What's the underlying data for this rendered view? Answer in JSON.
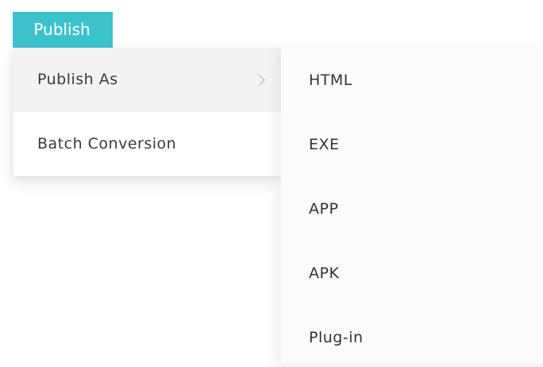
{
  "toolbar": {
    "publish_label": "Publish",
    "accent_color": "#3cc2cd"
  },
  "main_menu": {
    "items": [
      {
        "label": "Publish As",
        "has_submenu": true,
        "active": true,
        "icon": "chevron-right-icon"
      },
      {
        "label": "Batch Conversion",
        "has_submenu": false,
        "active": false
      }
    ]
  },
  "submenu": {
    "parent": "Publish As",
    "items": [
      {
        "label": "HTML"
      },
      {
        "label": "EXE"
      },
      {
        "label": "APP"
      },
      {
        "label": "APK"
      },
      {
        "label": "Plug-in"
      }
    ]
  }
}
